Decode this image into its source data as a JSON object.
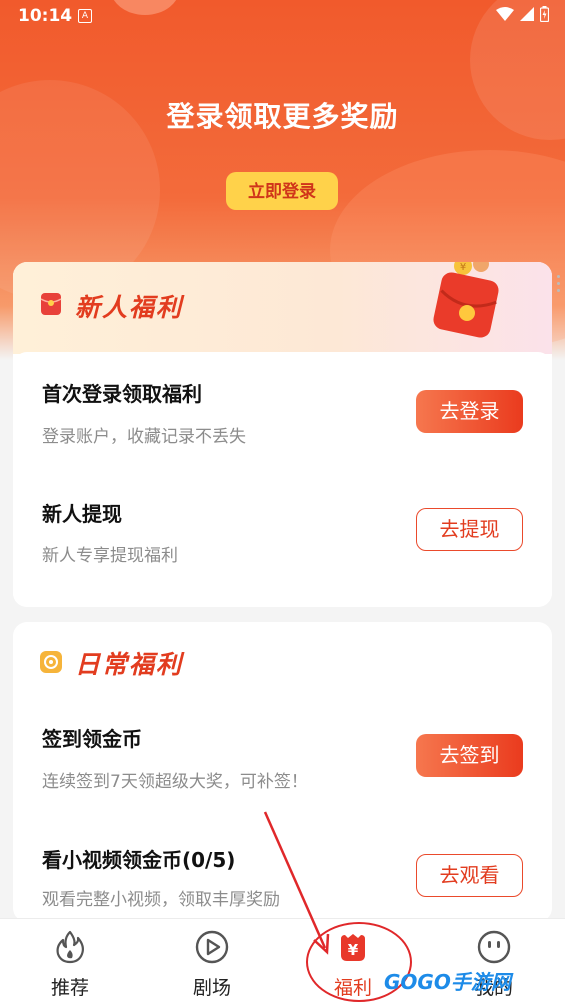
{
  "status_bar": {
    "time": "10:14",
    "notif_icon": "A"
  },
  "hero": {
    "title": "登录领取更多奖励",
    "login_button": "立即登录"
  },
  "newbie": {
    "title": "新人福利",
    "items": [
      {
        "title": "首次登录领取福利",
        "subtitle": "登录账户，收藏记录不丢失",
        "button": "去登录",
        "style": "filled"
      },
      {
        "title": "新人提现",
        "subtitle": "新人专享提现福利",
        "button": "去提现",
        "style": "outline"
      }
    ]
  },
  "daily": {
    "title": "日常福利",
    "items": [
      {
        "title": "签到领金币",
        "subtitle": "连续签到7天领超级大奖，可补签！",
        "button": "去签到",
        "style": "filled"
      },
      {
        "title": "看小视频领金币(0/5)",
        "subtitle": "观看完整小视频，领取丰厚奖励",
        "button": "去观看",
        "style": "outline"
      }
    ]
  },
  "nav": [
    {
      "label": "推荐",
      "icon": "flame-icon"
    },
    {
      "label": "剧场",
      "icon": "play-icon"
    },
    {
      "label": "福利",
      "icon": "yen-gift-icon",
      "active": true
    },
    {
      "label": "我的",
      "icon": "smiley-icon"
    }
  ],
  "watermark": "GOGO手游网",
  "colors": {
    "accent": "#ea3b1e",
    "brand": "#f15a2c",
    "button_yellow": "#ffd24a"
  }
}
